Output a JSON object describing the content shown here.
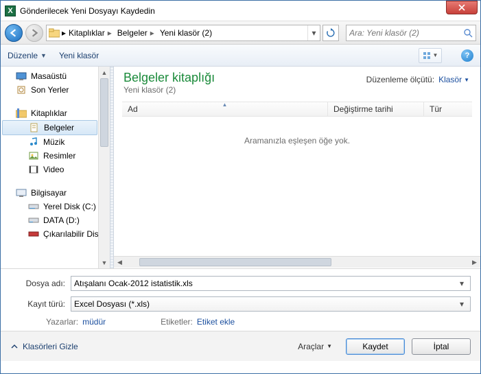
{
  "window": {
    "title": "Gönderilecek Yeni Dosyayı Kaydedin"
  },
  "breadcrumbs": {
    "a": "Kitaplıklar",
    "b": "Belgeler",
    "c": "Yeni klasör (2)"
  },
  "search": {
    "placeholder": "Ara: Yeni klasör (2)"
  },
  "toolbar": {
    "organize": "Düzenle",
    "newfolder": "Yeni klasör"
  },
  "library": {
    "title": "Belgeler kitaplığı",
    "subtitle": "Yeni klasör (2)",
    "arrange_label": "Düzenleme ölçütü:",
    "arrange_value": "Klasör"
  },
  "columns": {
    "name": "Ad",
    "date": "Değiştirme tarihi",
    "type": "Tür"
  },
  "empty_msg": "Aramanızla eşleşen öğe yok.",
  "tree": {
    "desktop": "Masaüstü",
    "recent": "Son Yerler",
    "libraries": "Kitaplıklar",
    "documents": "Belgeler",
    "music": "Müzik",
    "pictures": "Resimler",
    "video": "Video",
    "computer": "Bilgisayar",
    "localc": "Yerel Disk (C:)",
    "datad": "DATA (D:)",
    "removable": "Çıkarılabilir Disk ("
  },
  "form": {
    "filename_label": "Dosya adı:",
    "filename_value": "Atışalanı Ocak-2012 istatistik.xls",
    "filetype_label": "Kayıt türü:",
    "filetype_value": "Excel Dosyası (*.xls)",
    "authors_label": "Yazarlar:",
    "authors_value": "müdür",
    "tags_label": "Etiketler:",
    "tags_value": "Etiket ekle"
  },
  "footer": {
    "hide_folders": "Klasörleri Gizle",
    "tools": "Araçlar",
    "save": "Kaydet",
    "cancel": "İptal"
  }
}
